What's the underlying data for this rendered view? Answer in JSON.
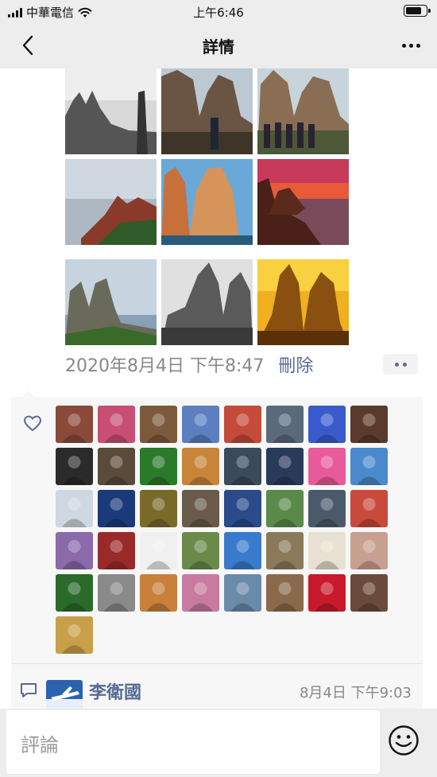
{
  "status_bar": {
    "carrier": "中華電信",
    "time": "上午6:46",
    "battery_level": 0.85
  },
  "nav": {
    "title": "詳情",
    "back_icon": "chevron-left-icon",
    "more_icon": "more-horizontal-icon"
  },
  "post": {
    "photos": [
      {
        "name": "bw-rock-coast"
      },
      {
        "name": "rock-pillars-people"
      },
      {
        "name": "rock-pillars-group"
      },
      {
        "name": "misty-sea-rocks"
      },
      {
        "name": "orange-rock-pillars"
      },
      {
        "name": "sunset-rock-coast"
      },
      {
        "name": "twin-rocks-island"
      },
      {
        "name": "bw-rock-pillars"
      },
      {
        "name": "golden-rock-painting"
      }
    ],
    "timestamp": "2020年8月4日 下午8:47",
    "delete_label": "刪除"
  },
  "likes": {
    "icon": "heart-outline-icon",
    "count": 41,
    "colors": [
      "#8a4a3a",
      "#c84f74",
      "#7a5a3a",
      "#5b7fbf",
      "#c44a3a",
      "#5a6a7a",
      "#3a5acc",
      "#5a3a2a",
      "#2b2b2b",
      "#5a4a3a",
      "#2a7a2a",
      "#c8853a",
      "#3a4a5a",
      "#2a3a5a",
      "#e85a9a",
      "#4a8acc",
      "#cfd8e0",
      "#1a3a7a",
      "#7a6a2a",
      "#6a5a4a",
      "#2a4a8a",
      "#5a8a4a",
      "#4a5a6a",
      "#c84a3a",
      "#8a6aaa",
      "#9a2a2a",
      "#f0f0f0",
      "#6a8a4a",
      "#3a7acc",
      "#8a7a5a",
      "#e8e0d0",
      "#c8a090",
      "#2a6a2a",
      "#8a8a8a",
      "#c8803a",
      "#c87aa0",
      "#6a8aaa",
      "#8a6a4a",
      "#c81a2a",
      "#6a4a3a",
      "#c8a04a"
    ]
  },
  "comment": {
    "icon": "comment-icon",
    "author": "李衛國",
    "time": "8月4日 下午9:03"
  },
  "input": {
    "placeholder": "評論",
    "emoji_icon": "emoji-smile-icon"
  }
}
